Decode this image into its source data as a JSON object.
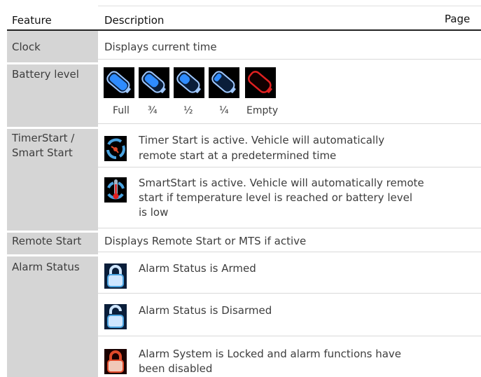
{
  "table": {
    "headers": {
      "feature": "Feature",
      "description": "Description",
      "page": "Page"
    },
    "rows": {
      "clock": {
        "feature": "Clock",
        "description": "Displays current time"
      },
      "battery": {
        "feature": "Battery level",
        "levels": [
          "Full",
          "¾",
          "½",
          "¼",
          "Empty"
        ],
        "fills": [
          1.0,
          0.75,
          0.5,
          0.25,
          0
        ]
      },
      "timer": {
        "feature_line1": "TimerStart /",
        "feature_line2": "Smart Start",
        "timer_line1": "Timer Start is active. Vehicle will automatically",
        "timer_line2": "remote start at a predetermined time",
        "smart_line1": "SmartStart is active. Vehicle will automatically remote",
        "smart_line2": "start if temperature level is reached or battery level",
        "smart_line3": "is low"
      },
      "remote": {
        "feature": "Remote Start",
        "description": "Displays Remote Start or MTS if active"
      },
      "alarm": {
        "feature": "Alarm Status",
        "armed": "Alarm Status is Armed",
        "disarmed": "Alarm Status is Disarmed",
        "locked_line1": "Alarm System is Locked and alarm functions have",
        "locked_line2": "been disabled"
      }
    }
  },
  "colors": {
    "feature_column": "#d5d5d5",
    "battery_blue": "#2f8cff",
    "battery_empty_red": "#e02020",
    "lock_blue": "#4aa3e0",
    "lock_red": "#e04a2a"
  },
  "icons": {
    "battery": "battery-icon",
    "timer_start": "timer-start-icon",
    "smart_start": "smart-start-thermometer-icon",
    "armed": "lock-closed-icon",
    "disarmed": "lock-open-icon",
    "locked": "lock-disabled-icon"
  }
}
